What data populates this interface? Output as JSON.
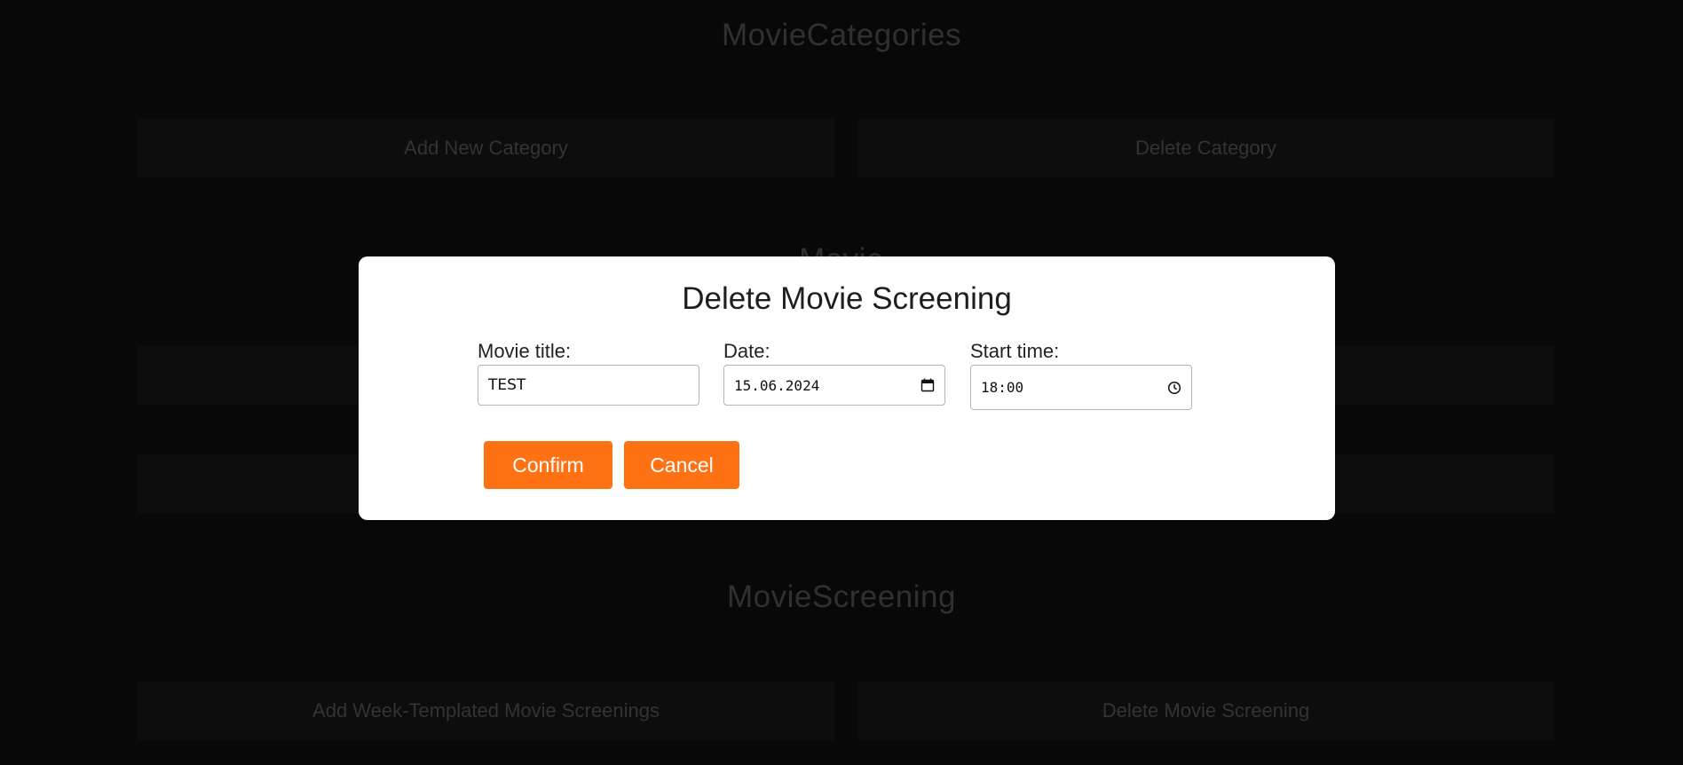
{
  "background": {
    "sections": [
      {
        "title": "MovieCategories",
        "buttons": [
          "Add New Category",
          "Delete Category"
        ]
      },
      {
        "title": "Movie"
      },
      {
        "title": "MovieScreening",
        "buttons": [
          "Add Week-Templated Movie Screenings",
          "Delete Movie Screening"
        ]
      }
    ]
  },
  "modal": {
    "title": "Delete Movie Screening",
    "fields": {
      "movie_title": {
        "label": "Movie title:",
        "value": "TEST"
      },
      "date": {
        "label": "Date:",
        "value": "15.06.2024",
        "icon": "calendar-icon"
      },
      "start_time": {
        "label": "Start time:",
        "value": "18:00",
        "icon": "clock-icon"
      }
    },
    "confirm_label": "Confirm",
    "cancel_label": "Cancel"
  },
  "colors": {
    "accent": "#ff7214",
    "modal_bg": "#ffffff",
    "page_bg": "#0d0d0d"
  }
}
